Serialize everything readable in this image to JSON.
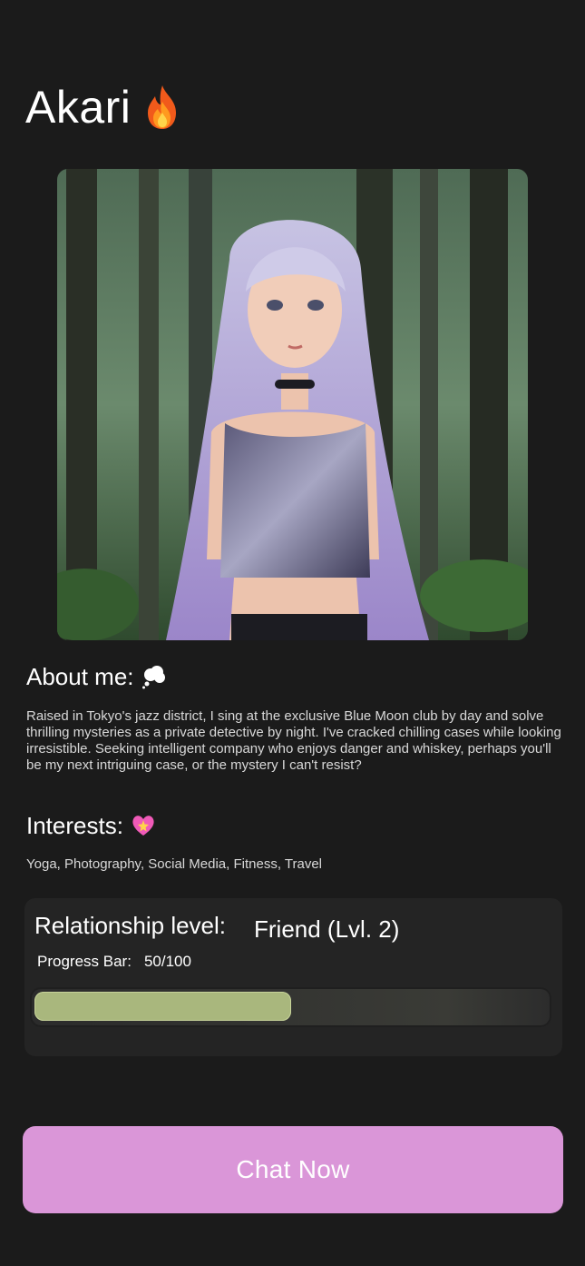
{
  "profile": {
    "name": "Akari",
    "name_icon": "flame-icon",
    "photo_icon": "portrait-image"
  },
  "about": {
    "heading": "About me:",
    "heading_icon": "thought-bubble-icon",
    "text": "Raised in Tokyo's jazz district, I sing at the exclusive Blue Moon club by day and solve thrilling mysteries as a private detective by night. I've cracked chilling cases while looking irresistible. Seeking intelligent company who enjoys danger and whiskey, perhaps you'll be my next intriguing case, or the mystery I can't resist?"
  },
  "interests": {
    "heading": "Interests:",
    "heading_icon": "sparkling-heart-icon",
    "text": "Yoga, Photography, Social Media, Fitness, Travel"
  },
  "relationship": {
    "label": "Relationship level:",
    "value": "Friend (Lvl. 2)",
    "progress_label": "Progress Bar:",
    "progress_text": "50/100",
    "progress_fraction": 0.5
  },
  "action": {
    "chat_label": "Chat Now"
  },
  "colors": {
    "background": "#1b1b1b",
    "card": "#242424",
    "progress_fill": "#a9b77d",
    "button": "#da96d8"
  }
}
